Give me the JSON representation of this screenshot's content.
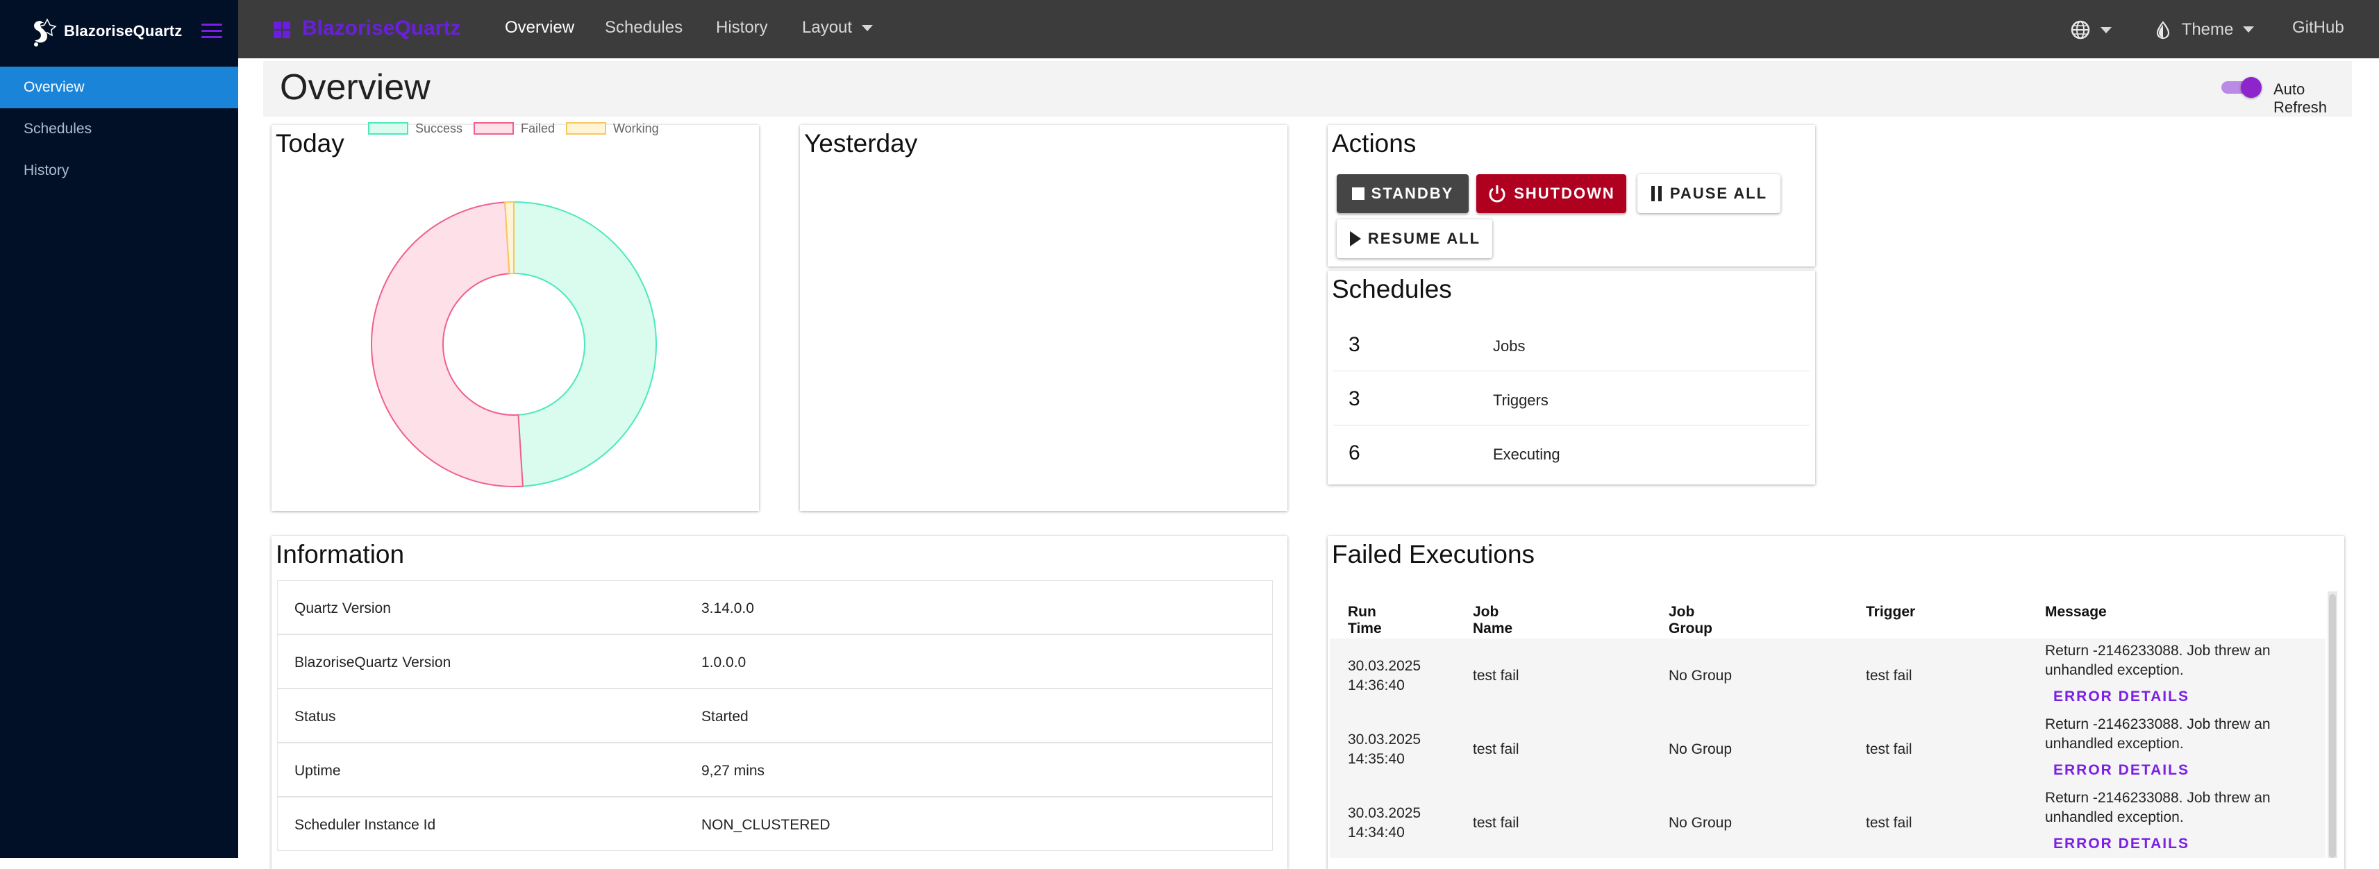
{
  "sidebar": {
    "brand": "BlazoriseQuartz",
    "items": [
      {
        "label": "Overview",
        "active": true
      },
      {
        "label": "Schedules",
        "active": false
      },
      {
        "label": "History",
        "active": false
      }
    ]
  },
  "topbar": {
    "title": "BlazoriseQuartz",
    "nav": [
      "Overview",
      "Schedules",
      "History",
      "Layout"
    ],
    "theme_label": "Theme",
    "github_label": "GitHub"
  },
  "page": {
    "title": "Overview",
    "auto_refresh_label": "Auto Refresh",
    "auto_refresh_on": true
  },
  "today": {
    "title": "Today",
    "chart_data": {
      "type": "pie",
      "categories": [
        "Success",
        "Failed",
        "Working"
      ],
      "values": [
        49,
        50,
        1
      ],
      "colors": [
        "#d9fcef",
        "#fde0e8",
        "#fff4d6"
      ],
      "border_colors": [
        "#4ce8bd",
        "#f0608c",
        "#f6c85f"
      ],
      "legend_position": "top",
      "donut": true
    }
  },
  "yesterday": {
    "title": "Yesterday"
  },
  "actions": {
    "title": "Actions",
    "standby": "STANDBY",
    "shutdown": "SHUTDOWN",
    "pause_all": "PAUSE ALL",
    "resume_all": "RESUME ALL"
  },
  "schedules": {
    "title": "Schedules",
    "rows": [
      {
        "value": "3",
        "label": "Jobs"
      },
      {
        "value": "3",
        "label": "Triggers"
      },
      {
        "value": "6",
        "label": "Executing"
      }
    ]
  },
  "information": {
    "title": "Information",
    "rows": [
      {
        "key": "Quartz Version",
        "value": "3.14.0.0"
      },
      {
        "key": "BlazoriseQuartz Version",
        "value": "1.0.0.0"
      },
      {
        "key": "Status",
        "value": "Started"
      },
      {
        "key": "Uptime",
        "value": "9,27 mins"
      },
      {
        "key": "Scheduler Instance Id",
        "value": "NON_CLUSTERED"
      }
    ]
  },
  "failed": {
    "title": "Failed Executions",
    "columns": [
      "Run Time",
      "Job Name",
      "Job Group",
      "Trigger",
      "Message"
    ],
    "error_details_label": "ERROR DETAILS",
    "rows": [
      {
        "date": "30.03.2025",
        "time": "14:36:40",
        "job": "test fail",
        "group": "No Group",
        "trigger": "test fail",
        "msg1": "Return -2146233088. Job threw an",
        "msg2": "unhandled exception."
      },
      {
        "date": "30.03.2025",
        "time": "14:35:40",
        "job": "test fail",
        "group": "No Group",
        "trigger": "test fail",
        "msg1": "Return -2146233088. Job threw an",
        "msg2": "unhandled exception."
      },
      {
        "date": "30.03.2025",
        "time": "14:34:40",
        "job": "test fail",
        "group": "No Group",
        "trigger": "test fail",
        "msg1": "Return -2146233088. Job threw an",
        "msg2": "unhandled exception."
      }
    ]
  }
}
